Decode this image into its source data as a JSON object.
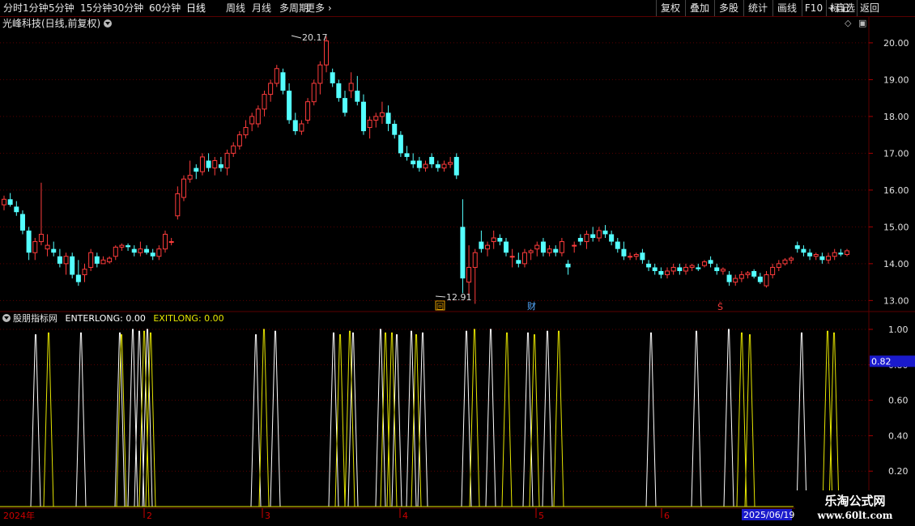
{
  "toolbar": {
    "left_items": [
      "分时",
      "1分钟",
      "5分钟",
      "15分钟",
      "30分钟",
      "60分钟",
      "日线",
      "周线",
      "月线",
      "多周期",
      "更多"
    ],
    "active": "日线",
    "right_items": [
      "复权",
      "叠加",
      "多股",
      "统计",
      "画线",
      "F10",
      "+自选",
      "返回"
    ],
    "mark_label": "标记"
  },
  "title": "光峰科技(日线,前复权)",
  "indicator": {
    "name": "股朋指标网",
    "enter_label": "ENTERLONG: 0.00",
    "exit_label": "EXITLONG: 0.00"
  },
  "price_axis": {
    "ticks": [
      "20.00",
      "19.00",
      "18.00",
      "17.00",
      "16.00",
      "15.00",
      "14.00",
      "13.00"
    ],
    "min": 12.7,
    "max": 20.35
  },
  "ind_axis": {
    "ticks": [
      "1.00",
      "0.80",
      "0.60",
      "0.40",
      "0.20"
    ],
    "current": "0.82"
  },
  "annotations": {
    "high": "20.17",
    "low": "12.91",
    "cai": "财",
    "s_mark": "Ŝ",
    "hui": "回"
  },
  "time_axis": {
    "labels": [
      "2024年",
      "2",
      "3",
      "4",
      "5",
      "6"
    ],
    "current_date": "2025/06/19"
  },
  "watermark": {
    "name": "乐淘公式网",
    "url": "www.60lt.com"
  },
  "colors": {
    "up": "#ff3c3c",
    "down": "#54ffff",
    "enter": "#ffffff",
    "exit": "#e6e600",
    "grid": "#5a0000"
  },
  "chart_data": {
    "type": "candlestick",
    "ohlc": [
      [
        15.6,
        15.85,
        15.45,
        15.75
      ],
      [
        15.75,
        15.92,
        15.55,
        15.6
      ],
      [
        15.55,
        15.7,
        15.3,
        15.4
      ],
      [
        15.35,
        15.45,
        14.8,
        14.9
      ],
      [
        14.9,
        15.0,
        14.1,
        14.3
      ],
      [
        14.3,
        14.7,
        14.1,
        14.6
      ],
      [
        14.6,
        16.2,
        14.5,
        14.8
      ],
      [
        14.4,
        14.8,
        14.2,
        14.5
      ],
      [
        14.4,
        14.6,
        14.2,
        14.3
      ],
      [
        14.2,
        14.4,
        13.9,
        14.0
      ],
      [
        14.0,
        14.3,
        13.7,
        14.2
      ],
      [
        14.2,
        14.3,
        13.6,
        13.7
      ],
      [
        13.7,
        14.1,
        13.4,
        13.5
      ],
      [
        13.7,
        14.0,
        13.5,
        13.85
      ],
      [
        13.9,
        14.4,
        13.8,
        14.3
      ],
      [
        14.2,
        14.3,
        13.9,
        14.0
      ],
      [
        14.0,
        14.2,
        14.0,
        14.1
      ],
      [
        14.05,
        14.2,
        14.0,
        14.15
      ],
      [
        14.2,
        14.5,
        14.1,
        14.45
      ],
      [
        14.45,
        14.55,
        14.35,
        14.5
      ],
      [
        14.5,
        14.55,
        14.35,
        14.45
      ],
      [
        14.4,
        14.5,
        14.2,
        14.3
      ],
      [
        14.3,
        14.6,
        14.2,
        14.4
      ],
      [
        14.4,
        14.5,
        14.25,
        14.3
      ],
      [
        14.3,
        14.4,
        14.1,
        14.2
      ],
      [
        14.2,
        14.5,
        14.1,
        14.4
      ],
      [
        14.4,
        14.9,
        14.3,
        14.8
      ],
      [
        14.6,
        14.7,
        14.5,
        14.6
      ],
      [
        15.3,
        16.1,
        15.2,
        15.9
      ],
      [
        15.8,
        16.4,
        15.7,
        16.3
      ],
      [
        16.3,
        16.8,
        16.2,
        16.4
      ],
      [
        16.6,
        16.7,
        16.3,
        16.5
      ],
      [
        16.5,
        17.0,
        16.4,
        16.9
      ],
      [
        16.8,
        17.0,
        16.5,
        16.6
      ],
      [
        16.6,
        16.9,
        16.4,
        16.8
      ],
      [
        16.7,
        16.9,
        16.5,
        16.6
      ],
      [
        16.6,
        17.1,
        16.4,
        17.0
      ],
      [
        17.0,
        17.3,
        16.9,
        17.2
      ],
      [
        17.2,
        17.6,
        17.1,
        17.5
      ],
      [
        17.5,
        17.9,
        17.4,
        17.7
      ],
      [
        17.8,
        18.1,
        17.6,
        18.0
      ],
      [
        17.8,
        18.3,
        17.7,
        18.2
      ],
      [
        18.2,
        18.7,
        18.0,
        18.6
      ],
      [
        18.6,
        19.0,
        18.4,
        18.9
      ],
      [
        18.9,
        19.4,
        18.8,
        19.3
      ],
      [
        19.2,
        19.3,
        18.6,
        18.7
      ],
      [
        18.7,
        18.9,
        17.8,
        17.9
      ],
      [
        17.9,
        18.1,
        17.5,
        17.6
      ],
      [
        17.6,
        17.9,
        17.5,
        17.8
      ],
      [
        17.9,
        18.5,
        17.8,
        18.4
      ],
      [
        18.4,
        19.0,
        18.3,
        18.9
      ],
      [
        18.9,
        19.5,
        18.6,
        19.4
      ],
      [
        19.4,
        20.17,
        19.2,
        20.05
      ],
      [
        19.2,
        19.3,
        18.8,
        18.9
      ],
      [
        18.9,
        19.0,
        18.4,
        18.5
      ],
      [
        18.5,
        18.7,
        18.0,
        18.1
      ],
      [
        18.7,
        19.2,
        18.5,
        18.9
      ],
      [
        18.7,
        19.1,
        18.3,
        18.4
      ],
      [
        18.4,
        18.6,
        17.5,
        17.6
      ],
      [
        17.7,
        18.0,
        17.4,
        17.9
      ],
      [
        17.9,
        18.1,
        17.7,
        18.0
      ],
      [
        18.0,
        18.4,
        17.8,
        18.1
      ],
      [
        18.1,
        18.3,
        17.6,
        17.8
      ],
      [
        17.8,
        17.9,
        17.4,
        17.5
      ],
      [
        17.5,
        17.6,
        16.9,
        17.0
      ],
      [
        17.0,
        17.2,
        16.8,
        16.9
      ],
      [
        16.8,
        17.0,
        16.6,
        16.7
      ],
      [
        16.8,
        16.9,
        16.5,
        16.6
      ],
      [
        16.6,
        16.8,
        16.5,
        16.7
      ],
      [
        16.9,
        17.0,
        16.6,
        16.7
      ],
      [
        16.7,
        16.8,
        16.5,
        16.6
      ],
      [
        16.6,
        16.8,
        16.5,
        16.7
      ],
      [
        16.7,
        16.9,
        16.6,
        16.75
      ],
      [
        16.9,
        17.0,
        16.3,
        16.4
      ],
      [
        15.0,
        15.75,
        13.2,
        13.6
      ],
      [
        13.5,
        14.5,
        13.1,
        13.9
      ],
      [
        13.9,
        14.4,
        12.91,
        14.3
      ],
      [
        14.6,
        14.9,
        14.3,
        14.4
      ],
      [
        14.4,
        14.6,
        14.2,
        14.5
      ],
      [
        14.6,
        14.9,
        14.4,
        14.7
      ],
      [
        14.7,
        14.8,
        14.5,
        14.6
      ],
      [
        14.6,
        14.7,
        14.2,
        14.3
      ],
      [
        14.2,
        14.4,
        13.9,
        14.2
      ],
      [
        14.1,
        14.3,
        13.9,
        14.0
      ],
      [
        14.0,
        14.4,
        13.9,
        14.3
      ],
      [
        14.3,
        14.4,
        14.1,
        14.35
      ],
      [
        14.4,
        14.6,
        14.2,
        14.5
      ],
      [
        14.6,
        14.7,
        14.2,
        14.3
      ],
      [
        14.3,
        14.5,
        14.2,
        14.4
      ],
      [
        14.4,
        14.5,
        14.2,
        14.3
      ],
      [
        14.3,
        14.7,
        14.2,
        14.6
      ],
      [
        14.0,
        14.1,
        13.7,
        13.9
      ],
      [
        14.5,
        14.6,
        14.3,
        14.5
      ],
      [
        14.7,
        14.8,
        14.5,
        14.6
      ],
      [
        14.6,
        14.9,
        14.4,
        14.8
      ],
      [
        14.8,
        15.0,
        14.6,
        14.7
      ],
      [
        14.7,
        15.0,
        14.6,
        14.9
      ],
      [
        14.9,
        15.05,
        14.7,
        14.8
      ],
      [
        14.8,
        14.9,
        14.5,
        14.6
      ],
      [
        14.6,
        14.7,
        14.3,
        14.4
      ],
      [
        14.4,
        14.6,
        14.1,
        14.2
      ],
      [
        14.2,
        14.3,
        14.1,
        14.2
      ],
      [
        14.2,
        14.3,
        14.1,
        14.25
      ],
      [
        14.3,
        14.4,
        14.0,
        14.1
      ],
      [
        14.0,
        14.1,
        13.8,
        13.9
      ],
      [
        13.9,
        14.0,
        13.7,
        13.8
      ],
      [
        13.8,
        13.9,
        13.6,
        13.7
      ],
      [
        13.7,
        13.9,
        13.6,
        13.8
      ],
      [
        13.8,
        14.0,
        13.7,
        13.9
      ],
      [
        13.9,
        14.0,
        13.7,
        13.8
      ],
      [
        13.8,
        14.0,
        13.7,
        13.9
      ],
      [
        13.9,
        14.0,
        13.8,
        13.95
      ],
      [
        13.9,
        14.0,
        13.8,
        13.85
      ],
      [
        13.95,
        14.1,
        13.9,
        14.05
      ],
      [
        14.1,
        14.2,
        13.9,
        14.0
      ],
      [
        13.9,
        14.0,
        13.7,
        13.8
      ],
      [
        13.8,
        13.9,
        13.7,
        13.85
      ],
      [
        13.7,
        13.8,
        13.4,
        13.5
      ],
      [
        13.5,
        13.7,
        13.4,
        13.6
      ],
      [
        13.6,
        13.8,
        13.5,
        13.7
      ],
      [
        13.7,
        13.8,
        13.6,
        13.75
      ],
      [
        13.8,
        13.85,
        13.6,
        13.65
      ],
      [
        13.65,
        13.75,
        13.45,
        13.5
      ],
      [
        13.4,
        13.8,
        13.35,
        13.7
      ],
      [
        13.7,
        14.0,
        13.6,
        13.9
      ],
      [
        13.9,
        14.1,
        13.8,
        14.0
      ],
      [
        14.0,
        14.15,
        13.95,
        14.1
      ],
      [
        14.1,
        14.2,
        14.0,
        14.15
      ],
      [
        14.5,
        14.6,
        14.3,
        14.4
      ],
      [
        14.4,
        14.5,
        14.2,
        14.3
      ],
      [
        14.3,
        14.4,
        14.1,
        14.2
      ],
      [
        14.2,
        14.3,
        14.1,
        14.25
      ],
      [
        14.2,
        14.3,
        14.0,
        14.1
      ],
      [
        14.1,
        14.3,
        14.0,
        14.2
      ],
      [
        14.2,
        14.4,
        14.1,
        14.3
      ],
      [
        14.3,
        14.4,
        14.2,
        14.25
      ],
      [
        14.25,
        14.4,
        14.2,
        14.35
      ]
    ],
    "enter_signals": [
      0.97,
      0.98,
      0.98,
      1.0,
      0.99,
      1.0,
      0.97,
      0.99,
      0.98,
      0.98,
      1.0,
      0.97,
      0.99,
      0.98,
      0.99,
      1.0,
      0.98,
      0.99,
      0.98,
      0.99,
      1.0,
      0.98
    ],
    "exit_signals": [
      0.98,
      0.97,
      0.99,
      0.98,
      1.0,
      0.97,
      0.99,
      0.98,
      0.98,
      0.97,
      1.0,
      0.98,
      0.97,
      0.99,
      0.98,
      0.97,
      0.99,
      0.98
    ]
  }
}
